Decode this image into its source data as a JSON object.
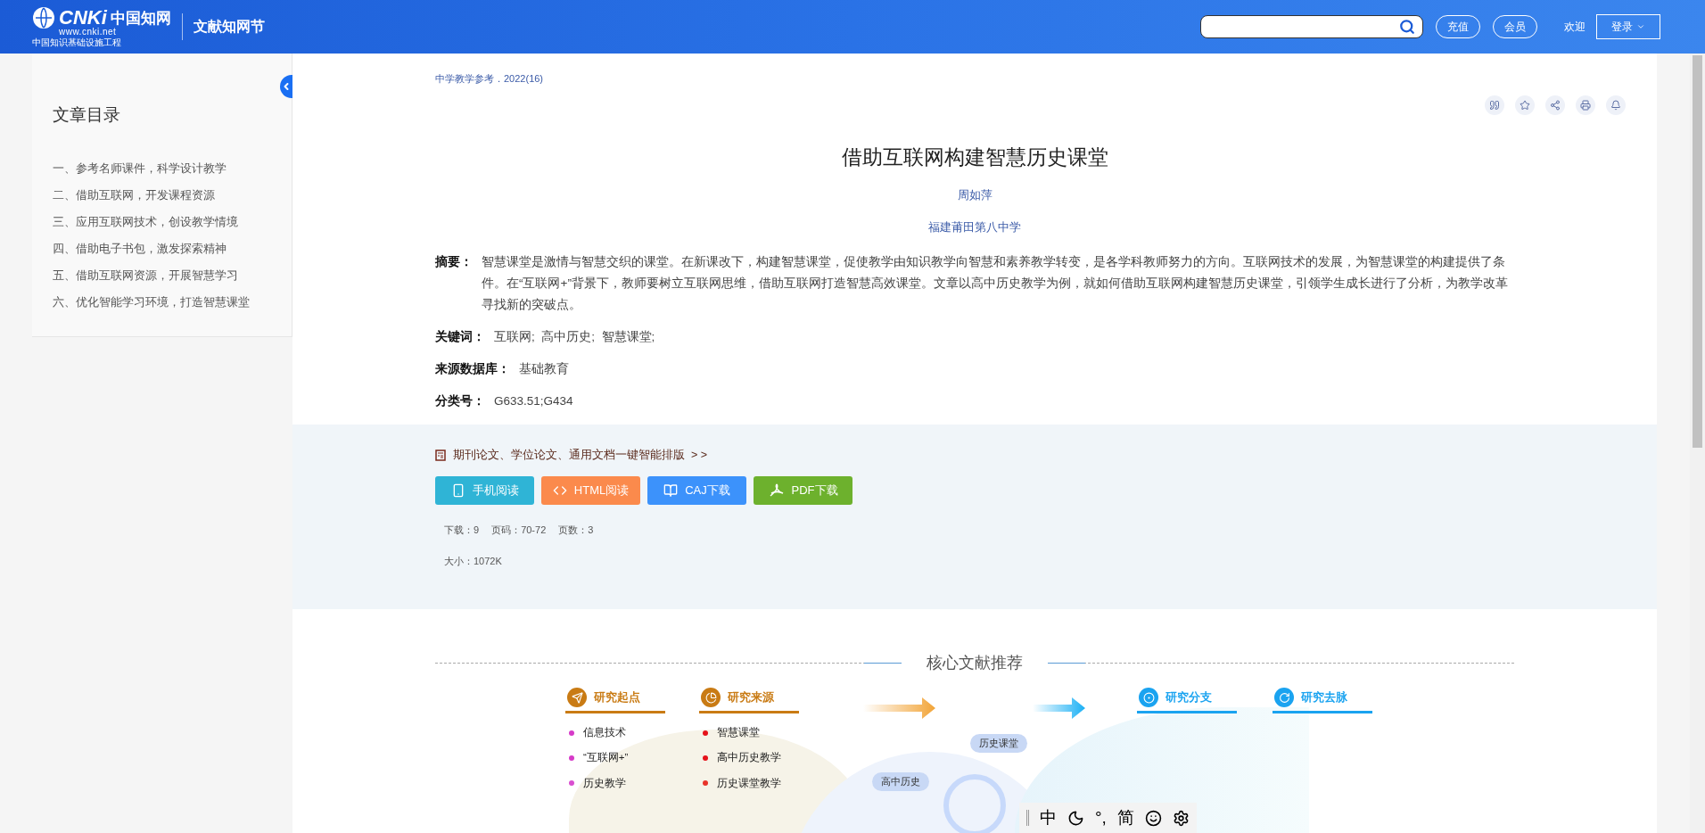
{
  "header": {
    "logo": {
      "brand": "CNKi",
      "brand_cn": "中国知网",
      "url": "www.cnki.net",
      "slogan": "中国知识基础设施工程"
    },
    "site_title": "文献知网节",
    "buttons": [
      "充值",
      "会员"
    ],
    "welcome": "欢迎",
    "login": "登录"
  },
  "sidebar": {
    "title": "文章目录",
    "items": [
      {
        "label": "一、参考名师课件，科学设计教学"
      },
      {
        "label": "二、借助互联网，开发课程资源"
      },
      {
        "label": "三、应用互联网技术，创设教学情境"
      },
      {
        "label": "四、借助电子书包，激发探索精神"
      },
      {
        "label": "五、借助互联网资源，开展智慧学习"
      },
      {
        "label": "六、优化智能学习环境，打造智慧课堂"
      }
    ]
  },
  "article": {
    "source": "中学教学参考．2022(16)",
    "title": "借助互联网构建智慧历史课堂",
    "author": "周如萍",
    "organization": "福建莆田第八中学",
    "fields": [
      {
        "label": "摘要：",
        "value": "智慧课堂是激情与智慧交织的课堂。在新课改下，构建智慧课堂，促使教学由知识教学向智慧和素养教学转变，是各学科教师努力的方向。互联网技术的发展，为智慧课堂的构建提供了条件。在“互联网+”背景下，教师要树立互联网思维，借助互联网打造智慧高效课堂。文章以高中历史教学为例，就如何借助互联网构建智慧历史课堂，引领学生成长进行了分析，为教学改革寻找新的突破点。"
      },
      {
        "label": "关键词：",
        "value": "互联网;  高中历史;  智慧课堂;"
      },
      {
        "label": "来源数据库：",
        "value": "基础教育"
      },
      {
        "label": "分类号：",
        "value": "G633.51;G434"
      }
    ]
  },
  "downloads": {
    "promo": "期刊论文、学位论文、通用文档一键智能排版  > >",
    "buttons": [
      {
        "kind": "mobile",
        "label": "手机阅读",
        "color": "#2fb4d6"
      },
      {
        "kind": "html",
        "label": "HTML阅读",
        "color": "#fb8a4c"
      },
      {
        "kind": "caj",
        "label": "CAJ下载",
        "color": "#3c92fb"
      },
      {
        "kind": "pdf",
        "label": "PDF下载",
        "color": "#6db12d"
      }
    ],
    "stats": [
      "下载：9",
      "页码：70-72",
      "页数：3"
    ],
    "size": "大小：1072K"
  },
  "recommend": {
    "title": "核心文献推荐",
    "groups": [
      {
        "kind": "start",
        "title": "研究起点",
        "color": "#c97b14",
        "items": [
          {
            "text": "信息技术",
            "color": "#d63bc8"
          },
          {
            "text": "“互联网+”",
            "color": "#d63bc8"
          },
          {
            "text": "历史教学",
            "color": "#d94fd0"
          }
        ]
      },
      {
        "kind": "source",
        "title": "研究来源",
        "color": "#c97b14",
        "items": [
          {
            "text": "智慧课堂",
            "color": "#e5121a"
          },
          {
            "text": "高中历史教学",
            "color": "#e5121a"
          },
          {
            "text": "历史课堂教学",
            "color": "#e8332a"
          }
        ]
      },
      {
        "kind": "branch",
        "title": "研究分支",
        "color": "#1aa3f0"
      },
      {
        "kind": "trend",
        "title": "研究去脉",
        "color": "#1aa3f0"
      }
    ],
    "bubbles": [
      "历史课堂",
      "高中历史"
    ]
  },
  "ime_toolbar": {
    "items": [
      {
        "kind": "text",
        "label": "中"
      },
      {
        "kind": "moon"
      },
      {
        "kind": "text",
        "label": "°,"
      },
      {
        "kind": "text",
        "label": "简"
      },
      {
        "kind": "smile"
      },
      {
        "kind": "gear"
      }
    ]
  }
}
